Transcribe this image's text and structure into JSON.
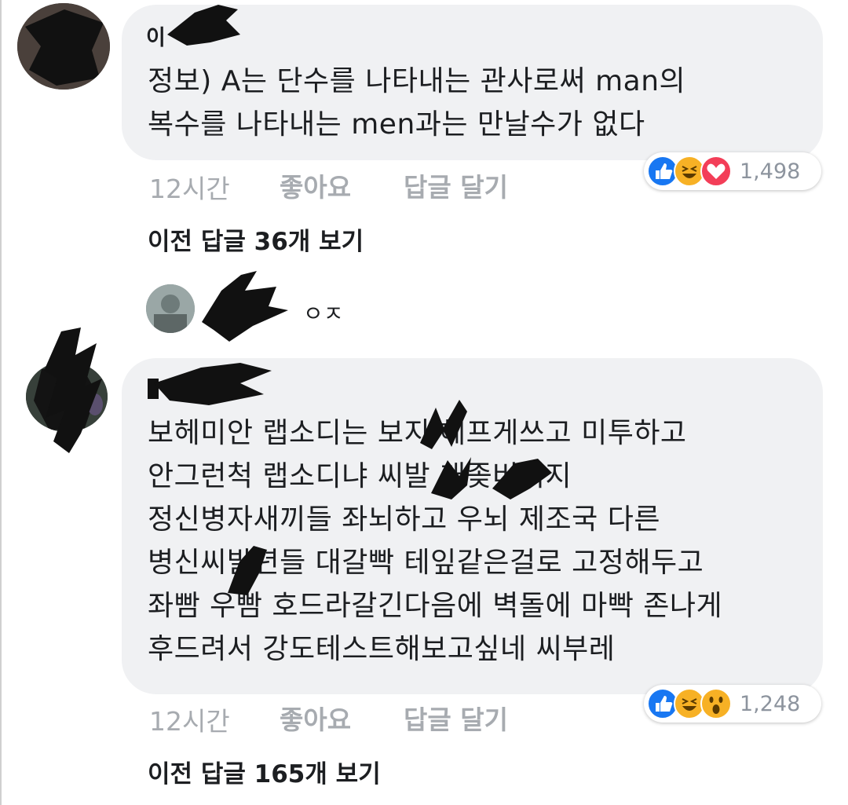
{
  "comments": [
    {
      "author_visible": "이",
      "lines": [
        "정보) A는 단수를 나타내는 관사로써 man의",
        "복수를 나타내는 men과는 만날수가 없다"
      ],
      "time": "12시간",
      "like_label": "좋아요",
      "reply_label": "답글 달기",
      "reactions": [
        "like-icon",
        "haha-icon",
        "love-icon"
      ],
      "reaction_count": "1,498",
      "view_replies": "이전 답글 36개 보기"
    },
    {
      "author_visible": "",
      "lines": [
        "보헤미안 랩소디는 보지 헤프게쓰고 미투하고",
        "안그런척 랩소디냐 씨발 개좆버러지",
        "정신병자새끼들 좌뇌하고 우뇌 제조국 다른",
        "병신씨발년들 대갈빡 테잎같은걸로 고정해두고",
        "좌빰 우빰 호드라갈긴다음에 벽돌에 마빡 존나게",
        "후드려서 강도테스트해보고싶네 씨부레"
      ],
      "time": "12시간",
      "like_label": "좋아요",
      "reply_label": "답글 달기",
      "reactions": [
        "like-icon",
        "haha-icon",
        "wow-icon"
      ],
      "reaction_count": "1,248",
      "view_replies": "이전 답글 165개 보기"
    }
  ],
  "reply_preview": {
    "text": "ㅇㅈ"
  },
  "colors": {
    "bubble": "#f0f1f3",
    "meta_text": "#a7abb0",
    "like_blue": "#1877f2",
    "love_red": "#f33e58",
    "haha_yellow": "#f7b125"
  }
}
